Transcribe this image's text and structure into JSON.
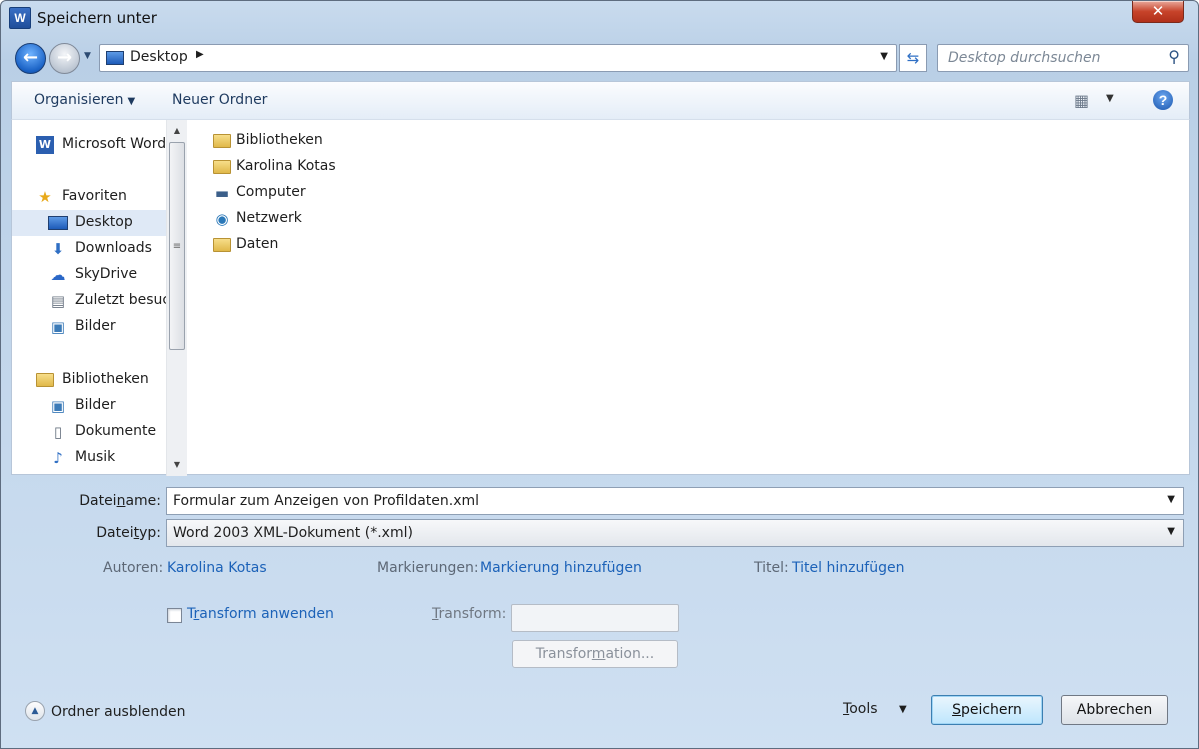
{
  "window": {
    "title": "Speichern unter",
    "app_icon": "W",
    "close_symbol": "✕"
  },
  "address": {
    "location": "Desktop",
    "search_placeholder": "Desktop durchsuchen"
  },
  "toolbar": {
    "organize_label": "Organisieren",
    "new_folder_label": "Neuer Ordner",
    "help_symbol": "?"
  },
  "nav": {
    "items": [
      {
        "label": "Microsoft Word",
        "icon": "word-icon"
      },
      {
        "label": "Favoriten",
        "icon": "star-icon"
      },
      {
        "label": "Desktop",
        "icon": "desktop-icon"
      },
      {
        "label": "Downloads",
        "icon": "downloads-icon"
      },
      {
        "label": "SkyDrive",
        "icon": "cloud-icon"
      },
      {
        "label": "Zuletzt besucht",
        "icon": "recent-places-icon"
      },
      {
        "label": "Bilder",
        "icon": "pictures-icon"
      },
      {
        "label": "Bibliotheken",
        "icon": "libraries-icon"
      },
      {
        "label": "Bilder",
        "icon": "pictures-icon"
      },
      {
        "label": "Dokumente",
        "icon": "documents-icon"
      },
      {
        "label": "Musik",
        "icon": "music-icon"
      }
    ]
  },
  "files": [
    {
      "label": "Bibliotheken",
      "icon": "libraries-icon"
    },
    {
      "label": "Karolina Kotas",
      "icon": "user-folder-icon"
    },
    {
      "label": "Computer",
      "icon": "computer-icon"
    },
    {
      "label": "Netzwerk",
      "icon": "network-icon"
    },
    {
      "label": "Daten",
      "icon": "folder-icon"
    }
  ],
  "form": {
    "filename_label_pre": "Datei",
    "filename_label_ul": "n",
    "filename_label_post": "ame:",
    "filename_value": "Formular zum Anzeigen von Profildaten.xml",
    "filetype_label_pre": "Datei",
    "filetype_label_ul": "t",
    "filetype_label_post": "yp:",
    "filetype_value": "Word 2003 XML-Dokument (*.xml)",
    "authors_label": "Autoren:",
    "authors_value": "Karolina Kotas",
    "tags_label": "Markierungen:",
    "tags_value": "Markierung hinzufügen",
    "title_label": "Titel:",
    "title_value": "Titel hinzufügen",
    "apply_transform_pre": "T",
    "apply_transform_ul": "r",
    "apply_transform_post": "ansform anwenden",
    "transform_label_ul": "T",
    "transform_label_post": "ransform:",
    "transformation_btn_pre": "Transfor",
    "transformation_btn_ul": "m",
    "transformation_btn_post": "ation..."
  },
  "footer": {
    "hide_folders_label": "Ordner ausblenden",
    "tools_ul": "T",
    "tools_post": "ools",
    "save_ul": "S",
    "save_post": "peichern",
    "cancel_label": "Abbrechen"
  },
  "colors": {
    "link": "#1c62b8",
    "selection": "#dfe9f6",
    "frame": "#c9dbee"
  }
}
